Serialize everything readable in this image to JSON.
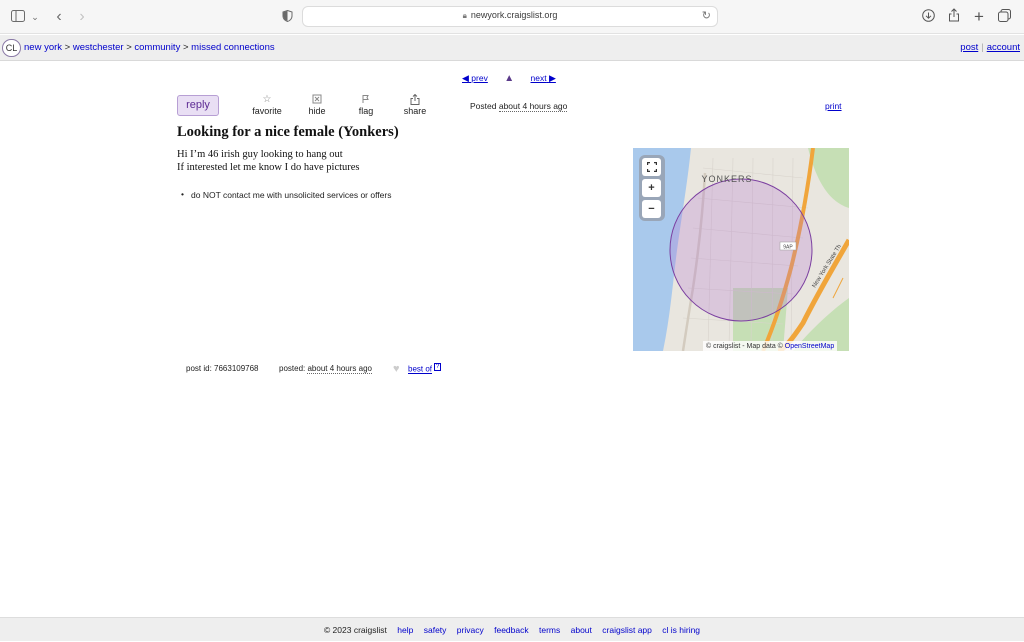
{
  "browser": {
    "url": "newyork.craigslist.org"
  },
  "header": {
    "logo": "CL",
    "crumbs": [
      "new york",
      "westchester",
      "community",
      "missed connections"
    ],
    "crumb_sep": ">",
    "post": "post",
    "account": "account"
  },
  "pager": {
    "prev": "prev",
    "next": "next"
  },
  "actions": {
    "reply": "reply",
    "favorite": "favorite",
    "hide": "hide",
    "flag": "flag",
    "share": "share",
    "posted_label": "Posted",
    "posted_time": "about 4 hours ago",
    "print": "print"
  },
  "post": {
    "title": "Looking for a nice female (Yonkers)",
    "body_line1": "Hi I’m 46 irish guy looking to hang out",
    "body_line2": "If interested let me know I do have pictures",
    "notice": "do NOT contact me with unsolicited services or offers"
  },
  "map": {
    "place_label": "YONKERS",
    "attribution": "© craigslist - Map data ©",
    "attribution_link": "OpenStreetMap",
    "road_label": "New York State Th",
    "exit_label": "9AP",
    "colors": {
      "water": "#a9c9ec",
      "land": "#e9e6df",
      "park": "#c6dfb5",
      "highway": "#f0a53b",
      "circle": "#7b3fa0"
    }
  },
  "postinginfo": {
    "post_id": "post id: 7663109768",
    "posted_label": "posted:",
    "posted_time": "about 4 hours ago",
    "best_of": "best of",
    "best_of_help": "?"
  },
  "footer": {
    "copyright": "© 2023 craigslist",
    "links": [
      "help",
      "safety",
      "privacy",
      "feedback",
      "terms",
      "about",
      "craigslist app",
      "cl is hiring"
    ]
  }
}
